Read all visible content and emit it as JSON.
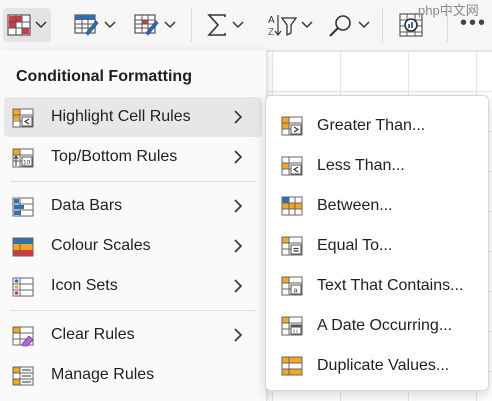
{
  "ribbon": {
    "watermark": "php中文网",
    "buttons": [
      {
        "name": "conditional-formatting",
        "icon": "conditional-formatting-icon"
      },
      {
        "name": "format-as-table",
        "icon": "format-table-icon"
      },
      {
        "name": "cell-styles",
        "icon": "cell-styles-icon"
      },
      {
        "name": "autosum",
        "icon": "sigma-icon"
      },
      {
        "name": "sort-filter",
        "icon": "sort-filter-icon"
      },
      {
        "name": "find-select",
        "icon": "search-icon"
      },
      {
        "name": "analyse-data",
        "icon": "analyse-data-icon"
      }
    ],
    "more": "•••"
  },
  "menu": {
    "title": "Conditional Formatting",
    "items": [
      {
        "label": "Highlight Cell Rules",
        "icon": "highlight-cell-rules-icon",
        "submenu": true,
        "active": true
      },
      {
        "label": "Top/Bottom Rules",
        "icon": "top-bottom-rules-icon",
        "submenu": true
      },
      {
        "label": "Data Bars",
        "icon": "data-bars-icon",
        "submenu": true
      },
      {
        "label": "Colour Scales",
        "icon": "colour-scales-icon",
        "submenu": true
      },
      {
        "label": "Icon Sets",
        "icon": "icon-sets-icon",
        "submenu": true
      },
      {
        "label": "Clear Rules",
        "icon": "clear-rules-icon",
        "submenu": true
      },
      {
        "label": "Manage Rules",
        "icon": "manage-rules-icon",
        "submenu": false
      }
    ]
  },
  "submenu": {
    "items": [
      {
        "label": "Greater Than...",
        "icon": "greater-than-icon"
      },
      {
        "label": "Less Than...",
        "icon": "less-than-icon"
      },
      {
        "label": "Between...",
        "icon": "between-icon"
      },
      {
        "label": "Equal To...",
        "icon": "equal-to-icon"
      },
      {
        "label": "Text That Contains...",
        "icon": "text-contains-icon"
      },
      {
        "label": "A Date Occurring...",
        "icon": "date-occurring-icon"
      },
      {
        "label": "Duplicate Values...",
        "icon": "duplicate-values-icon"
      }
    ]
  },
  "colors": {
    "accent_orange": "#f5a623",
    "accent_red": "#d0393f",
    "accent_blue": "#2f6fb4",
    "menu_bg": "#fafafa",
    "hover_bg": "#e7e7e7"
  }
}
